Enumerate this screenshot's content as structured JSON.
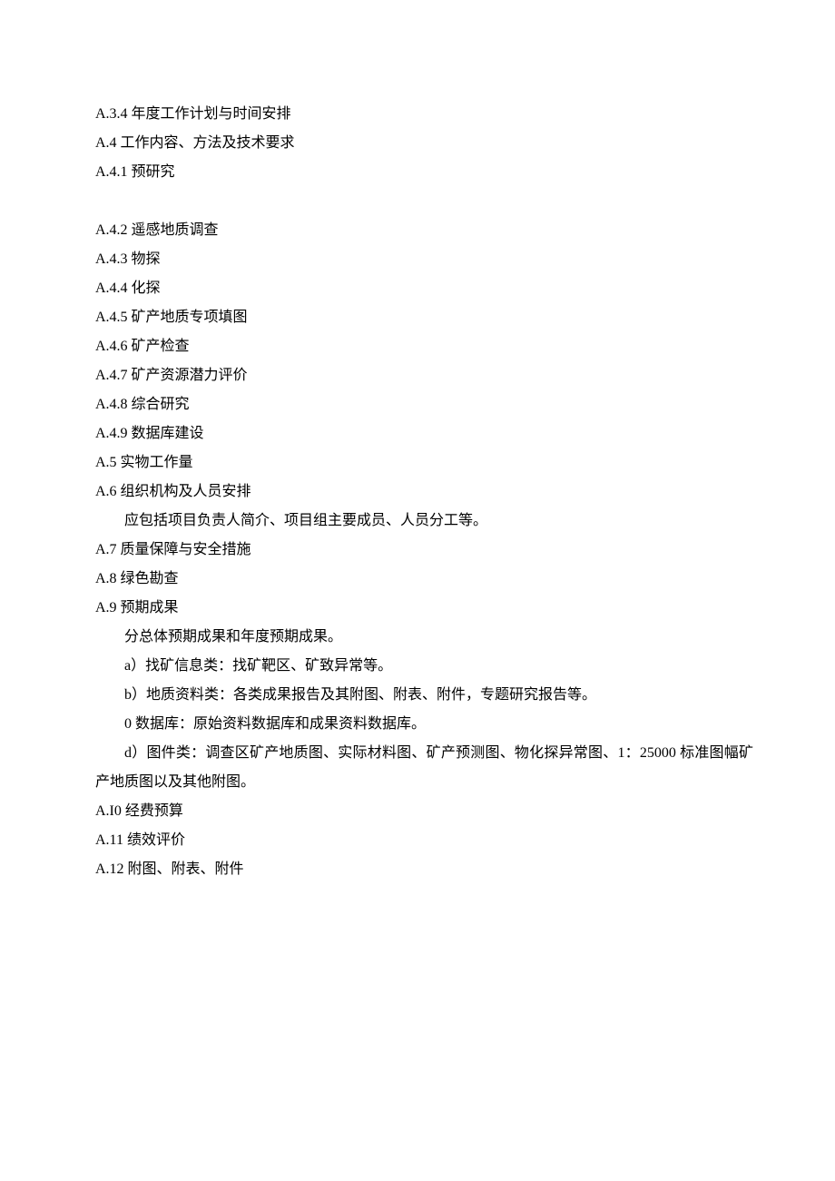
{
  "lines": {
    "l1": "A.3.4 年度工作计划与时间安排",
    "l2": "A.4 工作内容、方法及技术要求",
    "l3": "A.4.1 预研究",
    "l4": "A.4.2 遥感地质调查",
    "l5": "A.4.3 物探",
    "l6": "A.4.4 化探",
    "l7": "A.4.5 矿产地质专项填图",
    "l8": "A.4.6 矿产检查",
    "l9": "A.4.7 矿产资源潜力评价",
    "l10": "A.4.8 综合研究",
    "l11": "A.4.9 数据库建设",
    "l12": "A.5 实物工作量",
    "l13": "A.6 组织机构及人员安排",
    "l14": "应包括项目负责人简介、项目组主要成员、人员分工等。",
    "l15": "A.7 质量保障与安全措施",
    "l16": "A.8 绿色勘查",
    "l17": "A.9 预期成果",
    "l18": "分总体预期成果和年度预期成果。",
    "l19": "a）找矿信息类：找矿靶区、矿致异常等。",
    "l20": "b）地质资料类：各类成果报告及其附图、附表、附件，专题研究报告等。",
    "l21": "0 数据库：原始资料数据库和成果资料数据库。",
    "l22": "d）图件类：调查区矿产地质图、实际材料图、矿产预测图、物化探异常图、1：25000 标准图幅矿产地质图以及其他附图。",
    "l23": "A.I0 经费预算",
    "l24": "A.11 绩效评价",
    "l25": "A.12 附图、附表、附件"
  }
}
